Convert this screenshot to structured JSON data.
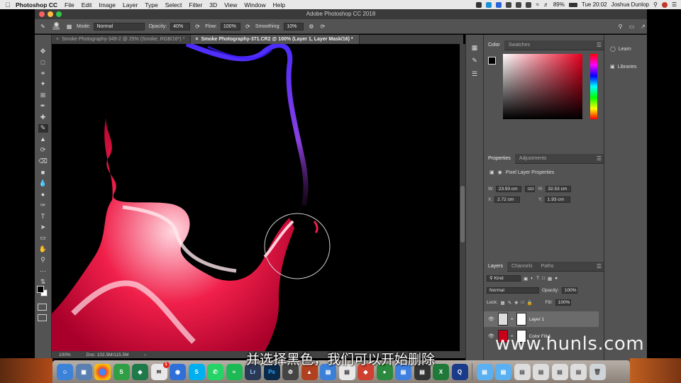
{
  "menubar": {
    "app_name": "Photoshop CC",
    "items": [
      "File",
      "Edit",
      "Image",
      "Layer",
      "Type",
      "Select",
      "Filter",
      "3D",
      "View",
      "Window",
      "Help"
    ],
    "battery": "89%",
    "clock": "Tue 20:02",
    "user": "Joshua Dunlop"
  },
  "window": {
    "title": "Adobe Photoshop CC 2018"
  },
  "options": {
    "brush_size": "396",
    "mode_label": "Mode:",
    "mode_value": "Normal",
    "opacity_label": "Opacity:",
    "opacity_value": "40%",
    "flow_label": "Flow:",
    "flow_value": "100%",
    "smoothing_label": "Smoothing:",
    "smoothing_value": "10%"
  },
  "tabs": [
    {
      "label": "Smoke Photography-349-2 @ 25% (Smoke, RGB/16*) *",
      "active": false
    },
    {
      "label": "Smoke Photography-371.CR2 @ 100% (Layer 1, Layer Mask/16) *",
      "active": true
    }
  ],
  "status": {
    "zoom": "100%",
    "doc": "Doc: 102.5M/115.5M"
  },
  "color_panel": {
    "tabs": [
      "Color",
      "Swatches"
    ]
  },
  "properties_panel": {
    "tabs": [
      "Properties",
      "Adjustments"
    ],
    "title": "Pixel Layer Properties",
    "w_label": "W:",
    "w_value": "23.93 cm",
    "h_label": "H:",
    "h_value": "32.53 cm",
    "x_label": "X:",
    "x_value": "2.72 cm",
    "y_label": "Y:",
    "y_value": "1.93 cm",
    "link": "GO"
  },
  "layers_panel": {
    "tabs": [
      "Layers",
      "Channels",
      "Paths"
    ],
    "kind_label": "Kind",
    "blend_mode": "Normal",
    "opacity_label": "Opacity:",
    "opacity_value": "100%",
    "lock_label": "Lock:",
    "fill_label": "Fill:",
    "fill_value": "100%",
    "layers": [
      {
        "name": "Layer 1",
        "selected": true
      },
      {
        "name": "Color Fill 1",
        "selected": false
      }
    ]
  },
  "right_panel": {
    "learn": "Learn",
    "libraries": "Libraries"
  },
  "subtitle": "并选择黑色，我们可以开始删除",
  "watermark": "www.hunls.com",
  "dock_badges": {
    "mail": "1"
  },
  "colors": {
    "smoke_red": "#e8143c",
    "smoke_blue": "#6a2cff",
    "panel_bg": "#535353"
  }
}
